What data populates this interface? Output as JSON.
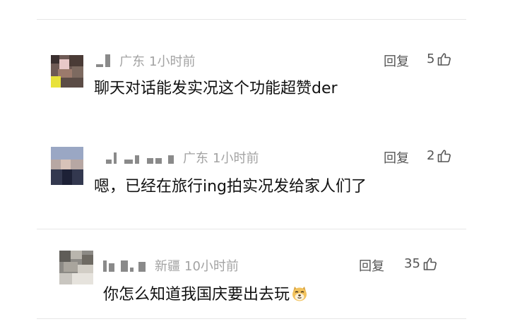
{
  "comments": [
    {
      "region": "广东",
      "time": "1小时前",
      "reply_label": "回复",
      "likes": "5",
      "text": "聊天对话能发实况这个功能超赞der"
    },
    {
      "region": "广东",
      "time": "1小时前",
      "reply_label": "回复",
      "likes": "2",
      "text": "嗯，已经在旅行ing拍实况发给家人们了"
    },
    {
      "region": "新疆",
      "time": "10小时前",
      "reply_label": "回复",
      "likes": "35",
      "text": "你怎么知道我国庆要出去玩",
      "emoji": "doge-face-emoji"
    }
  ],
  "icons": {
    "like": "thumbs-up-icon"
  },
  "colors": {
    "meta_text": "#a3a3a3",
    "action_text": "#555555",
    "body_text": "#111111",
    "divider": "#e6e6e6"
  }
}
